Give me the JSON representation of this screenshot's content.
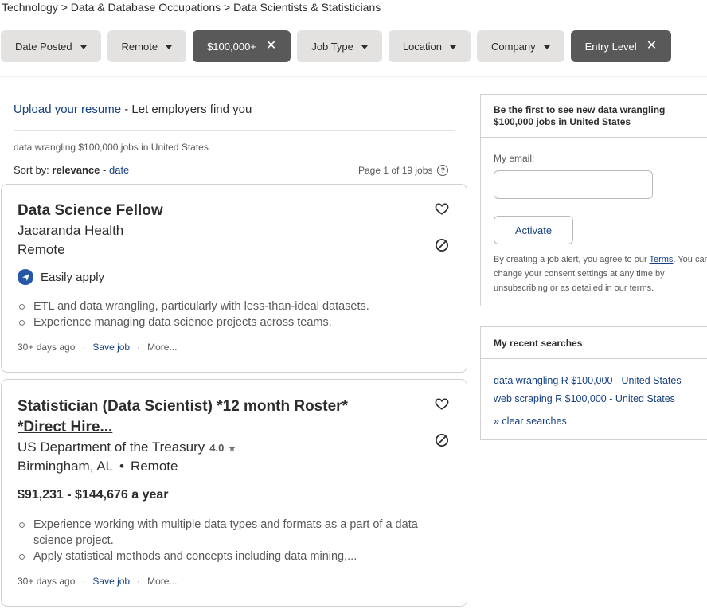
{
  "breadcrumb": "Technology > Data & Database Occupations > Data Scientists & Statisticians",
  "filters": [
    {
      "label": "Date Posted",
      "active": false
    },
    {
      "label": "Remote",
      "active": false
    },
    {
      "label": "$100,000+",
      "active": true
    },
    {
      "label": "Job Type",
      "active": false
    },
    {
      "label": "Location",
      "active": false
    },
    {
      "label": "Company",
      "active": false
    },
    {
      "label": "Entry Level",
      "active": true
    }
  ],
  "upload": {
    "link": "Upload your resume",
    "rest": " - Let employers find you"
  },
  "query_text": "data wrangling $100,000 jobs in United States",
  "sort": {
    "label": "Sort by:",
    "relevance": "relevance",
    "separator": " - ",
    "date": "date"
  },
  "page_info": "Page 1 of 19 jobs",
  "jobs": [
    {
      "title": "Data Science Fellow",
      "company": "Jacaranda Health",
      "location": "Remote",
      "easily_apply": "Easily apply",
      "snippets": [
        "ETL and data wrangling, particularly with less-than-ideal datasets.",
        "Experience managing data science projects across teams."
      ],
      "posted": "30+ days ago",
      "save": "Save job",
      "more": "More..."
    },
    {
      "title": "Statistician (Data Scientist) *12 month Roster* *Direct Hire...",
      "company": "US Department of the Treasury",
      "rating": "4.0",
      "city": "Birmingham, AL",
      "location": "Remote",
      "salary": "$91,231 - $144,676 a year",
      "snippets": [
        "Experience working with multiple data types and formats as a part of a data science project.",
        "Apply statistical methods and concepts including data mining,..."
      ],
      "posted": "30+ days ago",
      "save": "Save job",
      "more": "More..."
    }
  ],
  "alert": {
    "heading": "Be the first to see new data wrangling $100,000 jobs in United States",
    "email_label": "My email:",
    "activate": "Activate",
    "terms_pre": "By creating a job alert, you agree to our ",
    "terms_link": "Terms",
    "terms_post": ". You can change your consent settings at any time by unsubscribing or as detailed in our terms."
  },
  "recent": {
    "heading": "My recent searches",
    "items": [
      "data wrangling R $100,000 - United States",
      "web scraping R $100,000 - United States"
    ],
    "clear": "» clear searches"
  },
  "colors": {
    "link": "#164081",
    "active_chip": "#595959",
    "chip": "#e4e2e0",
    "apply_icon": "#2557a7"
  }
}
